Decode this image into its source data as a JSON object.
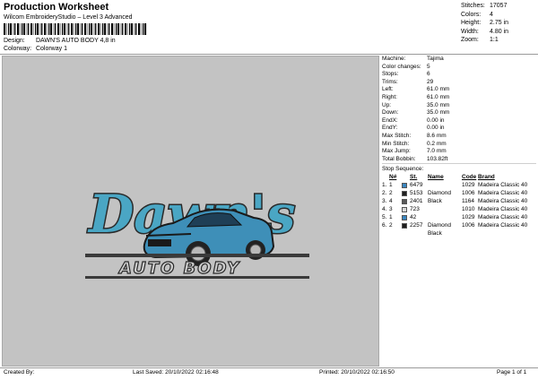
{
  "header": {
    "title": "Production Worksheet",
    "subtitle": "Wilcom EmbroideryStudio – Level 3 Advanced",
    "design_label": "Design:",
    "design_value": "DAWN'S AUTO BODY 4,8 in",
    "colorway_label": "Colorway:",
    "colorway_value": "Colorway 1"
  },
  "summary": [
    {
      "k": "Stitches:",
      "v": "17057"
    },
    {
      "k": "Colors:",
      "v": "4"
    },
    {
      "k": "Height:",
      "v": "2.75 in"
    },
    {
      "k": "Width:",
      "v": "4.80 in"
    },
    {
      "k": "Zoom:",
      "v": "1:1"
    }
  ],
  "design": {
    "line1": "Dawn's",
    "line2": "AUTO BODY",
    "colors": {
      "teal": "#4aa6c4",
      "dark": "#2a2a2a",
      "car": "#3e8fb8",
      "bg": "#c3c3c3"
    }
  },
  "info": [
    {
      "k": "Machine:",
      "v": "Tajima"
    },
    {
      "k": "Color changes:",
      "v": "5"
    },
    {
      "k": "Stops:",
      "v": "6"
    },
    {
      "k": "Trims:",
      "v": "29"
    },
    {
      "k": "Left:",
      "v": "61.0 mm"
    },
    {
      "k": "Right:",
      "v": "61.0 mm"
    },
    {
      "k": "Up:",
      "v": "35.0 mm"
    },
    {
      "k": "Down:",
      "v": "35.0 mm"
    },
    {
      "k": "EndX:",
      "v": "0.00 in"
    },
    {
      "k": "EndY:",
      "v": "0.00 in"
    },
    {
      "k": "Max Stitch:",
      "v": "8.6 mm"
    },
    {
      "k": "Min Stitch:",
      "v": "0.2 mm"
    },
    {
      "k": "Max Jump:",
      "v": "7.0 mm"
    },
    {
      "k": "Total Bobbin:",
      "v": "103.82ft"
    }
  ],
  "sequence": {
    "title": "Stop Sequence:",
    "headers": [
      "N#",
      "St.",
      "Name",
      "Code",
      "Brand"
    ],
    "rows": [
      {
        "n": "1.",
        "no": "1",
        "color": "#3a86c0",
        "st": "6479",
        "name": "",
        "code": "1029",
        "brand": "Madeira Classic 40"
      },
      {
        "n": "2.",
        "no": "2",
        "color": "#1e1e1e",
        "st": "5153",
        "name": "Diamond Black",
        "code": "1006",
        "brand": "Madeira Classic 40"
      },
      {
        "n": "3.",
        "no": "4",
        "color": "#5a5a5a",
        "st": "2401",
        "name": "",
        "code": "1164",
        "brand": "Madeira Classic 40"
      },
      {
        "n": "4.",
        "no": "3",
        "color": "#d8d8d8",
        "st": "723",
        "name": "",
        "code": "1010",
        "brand": "Madeira Classic 40"
      },
      {
        "n": "5.",
        "no": "1",
        "color": "#3a86c0",
        "st": "42",
        "name": "",
        "code": "1029",
        "brand": "Madeira Classic 40"
      },
      {
        "n": "6.",
        "no": "2",
        "color": "#1e1e1e",
        "st": "2257",
        "name": "Diamond Black",
        "code": "1006",
        "brand": "Madeira Classic 40"
      }
    ]
  },
  "footer": {
    "created": "Created By:",
    "saved": "Last Saved: 20/10/2022 02:16:48",
    "printed": "Printed: 20/10/2022 02:16:50",
    "page": "Page 1 of 1"
  }
}
